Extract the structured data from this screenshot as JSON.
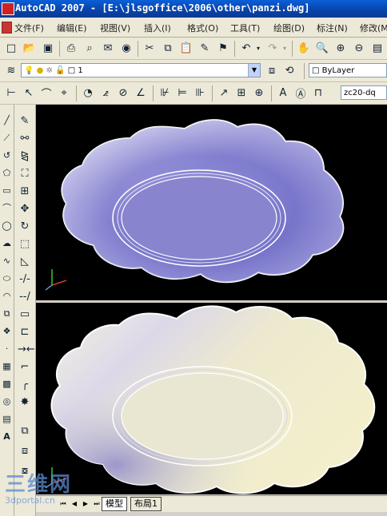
{
  "window": {
    "title": "AutoCAD 2007 - [E:\\jlsgoffice\\2006\\other\\panzi.dwg]"
  },
  "menubar": {
    "items": [
      "文件(F)",
      "编辑(E)",
      "视图(V)",
      "插入(I)",
      "格式(O)",
      "工具(T)",
      "绘图(D)",
      "标注(N)",
      "修改(M)"
    ]
  },
  "layers": {
    "current": "1",
    "linetype": "ByLayer"
  },
  "dimstyle": {
    "current": "zc20-dq"
  },
  "layout_tabs": [
    "模型",
    "布局1"
  ],
  "watermark": {
    "line1": "三维网",
    "line2": "3dportal.cn"
  },
  "colors": {
    "viewport_bg": "#000000",
    "plate_top": "#6f6cc4",
    "plate_bottom": "#ece7c8"
  }
}
